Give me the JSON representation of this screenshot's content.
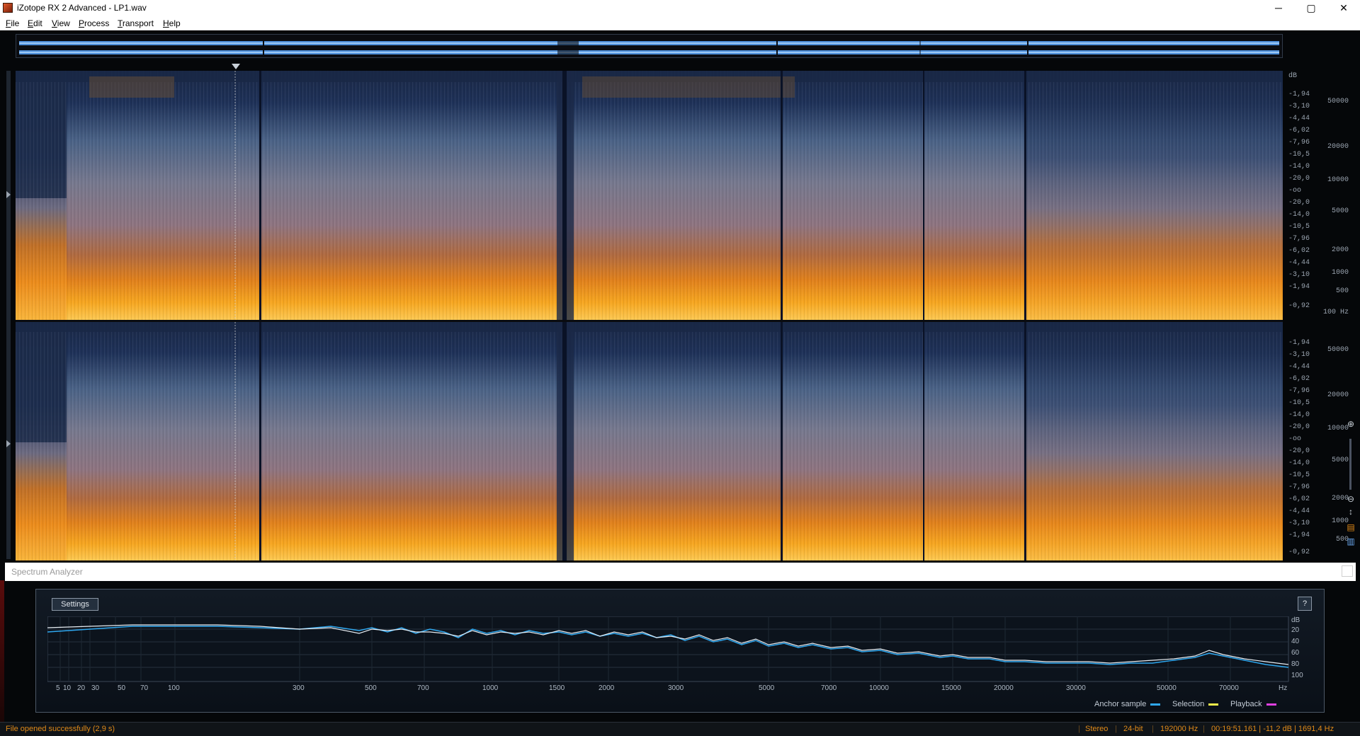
{
  "window": {
    "title": "iZotope RX 2 Advanced - LP1.wav",
    "controls": [
      "─",
      "▢",
      "✕"
    ]
  },
  "menu": [
    "File",
    "Edit",
    "View",
    "Process",
    "Transport",
    "Help"
  ],
  "scale": {
    "db_unit": "dB",
    "hz_unit": "Hz",
    "top_db": [
      "-1,94",
      "-3,10",
      "-4,44",
      "-6,02",
      "-7,96",
      "-10,5",
      "-14,0",
      "-20,0",
      "-oo",
      "-20,0",
      "-14,0",
      "-10,5",
      "-7,96",
      "-6,02",
      "-4,44",
      "-3,10",
      "-1,94",
      "-0,92"
    ],
    "top_hz": [
      "50000",
      "20000",
      "10000",
      "5000",
      "2000",
      "1000",
      "500",
      "100"
    ],
    "bottom_db": [
      "-1,94",
      "-3,10",
      "-4,44",
      "-6,02",
      "-7,96",
      "-10,5",
      "-14,0",
      "-20,0",
      "-oo",
      "-20,0",
      "-14,0",
      "-10,5",
      "-7,96",
      "-6,02",
      "-4,44",
      "-3,10",
      "-1,94",
      "-0,92"
    ],
    "bottom_hz": [
      "50000",
      "20000",
      "10000",
      "5000",
      "2000",
      "1000",
      "500"
    ]
  },
  "analyzer": {
    "title": "Spectrum Analyzer",
    "settings_label": "Settings",
    "help_label": "?",
    "db_unit": "dB",
    "db_ticks": [
      "20",
      "40",
      "60",
      "80",
      "100"
    ],
    "freq_ticks": [
      "5",
      "10",
      "20",
      "30",
      "50",
      "70",
      "100",
      "300",
      "500",
      "700",
      "1000",
      "1500",
      "2000",
      "3000",
      "5000",
      "7000",
      "10000",
      "15000",
      "20000",
      "30000",
      "50000",
      "70000",
      "Hz"
    ],
    "legend": [
      {
        "label": "Anchor sample",
        "color": "#2fa8f0"
      },
      {
        "label": "Selection",
        "color": "#f4f04a"
      },
      {
        "label": "Playback",
        "color": "#e040e0"
      }
    ]
  },
  "status": {
    "message": "File opened successfully (2,9 s)",
    "channels": "Stereo",
    "bit_depth": "24-bit",
    "sample_rate": "192000 Hz",
    "cursor": "00:19:51.161 | -11,2 dB | 1691,4 Hz"
  },
  "colors": {
    "accent_status": "#e08a18",
    "spectrogram_hot": "#f6a820",
    "spectrogram_cold": "#1c2c4a",
    "anchor_curve": "#2fa8f0",
    "selection_curve": "#e8eef4"
  }
}
